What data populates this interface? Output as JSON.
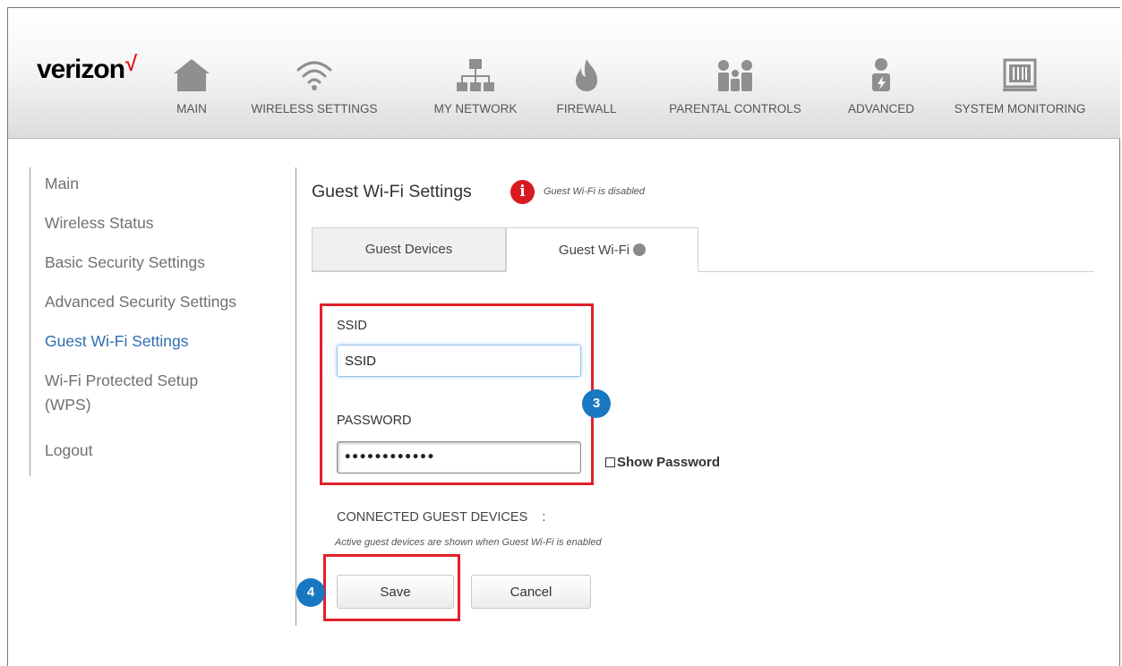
{
  "brand": {
    "name": "verizon",
    "mark": "√",
    "accent": "#e4141b"
  },
  "nav": [
    {
      "label": "MAIN",
      "icon": "home-icon"
    },
    {
      "label": "WIRELESS SETTINGS",
      "icon": "wifi-icon"
    },
    {
      "label": "MY NETWORK",
      "icon": "network-icon"
    },
    {
      "label": "FIREWALL",
      "icon": "flame-icon"
    },
    {
      "label": "PARENTAL CONTROLS",
      "icon": "family-icon"
    },
    {
      "label": "ADVANCED",
      "icon": "advanced-user-icon"
    },
    {
      "label": "SYSTEM MONITORING",
      "icon": "monitor-icon"
    }
  ],
  "sidebar": {
    "items": [
      {
        "label": "Main"
      },
      {
        "label": "Wireless Status"
      },
      {
        "label": "Basic Security Settings"
      },
      {
        "label": "Advanced Security Settings"
      },
      {
        "label": "Guest Wi-Fi Settings",
        "active": true
      },
      {
        "label": "Wi-Fi Protected Setup",
        "label2": "(WPS)"
      },
      {
        "label": "Logout"
      }
    ],
    "active_color": "#2f6fb0"
  },
  "main": {
    "title": "Guest Wi-Fi Settings",
    "info_glyph": "i",
    "status_note": "Guest Wi-Fi is disabled",
    "tabs": [
      {
        "label": "Guest Devices",
        "active": false
      },
      {
        "label": "Guest Wi-Fi",
        "active": true,
        "status": "disabled"
      }
    ],
    "ssid": {
      "label": "SSID",
      "value": "SSID"
    },
    "password": {
      "label": "PASSWORD",
      "value": "••••••••••••"
    },
    "show_password": {
      "label": "Show Password",
      "checked": false
    },
    "connected": {
      "label": "CONNECTED GUEST DEVICES",
      "separator": ":",
      "note": "Active guest devices are shown when Guest Wi-Fi is enabled"
    },
    "save_label": "Save",
    "cancel_label": "Cancel"
  },
  "annotations": {
    "step3": "3",
    "step4": "4",
    "highlight_color": "#e0202b",
    "badge_color": "#1878c1"
  }
}
